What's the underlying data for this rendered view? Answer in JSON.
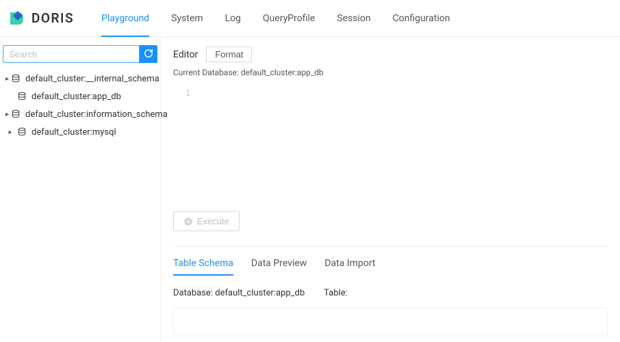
{
  "logo": {
    "text": "DORIS"
  },
  "nav": {
    "items": [
      {
        "label": "Playground",
        "active": true
      },
      {
        "label": "System",
        "active": false
      },
      {
        "label": "Log",
        "active": false
      },
      {
        "label": "QueryProfile",
        "active": false
      },
      {
        "label": "Session",
        "active": false
      },
      {
        "label": "Configuration",
        "active": false
      }
    ]
  },
  "sidebar": {
    "search_placeholder": "Search",
    "items": [
      {
        "label": "default_cluster:__internal_schema",
        "expandable": true
      },
      {
        "label": "default_cluster:app_db",
        "expandable": false
      },
      {
        "label": "default_cluster:information_schema",
        "expandable": true
      },
      {
        "label": "default_cluster:mysql",
        "expandable": true
      }
    ]
  },
  "editor": {
    "title": "Editor",
    "format_label": "Format",
    "current_db_label": "Current Database: default_cluster:app_db",
    "line1": "1",
    "execute_label": "Execute"
  },
  "tabs": {
    "items": [
      {
        "label": "Table Schema",
        "active": true
      },
      {
        "label": "Data Preview",
        "active": false
      },
      {
        "label": "Data Import",
        "active": false
      }
    ]
  },
  "info": {
    "database": "Database: default_cluster:app_db",
    "table": "Table:"
  }
}
